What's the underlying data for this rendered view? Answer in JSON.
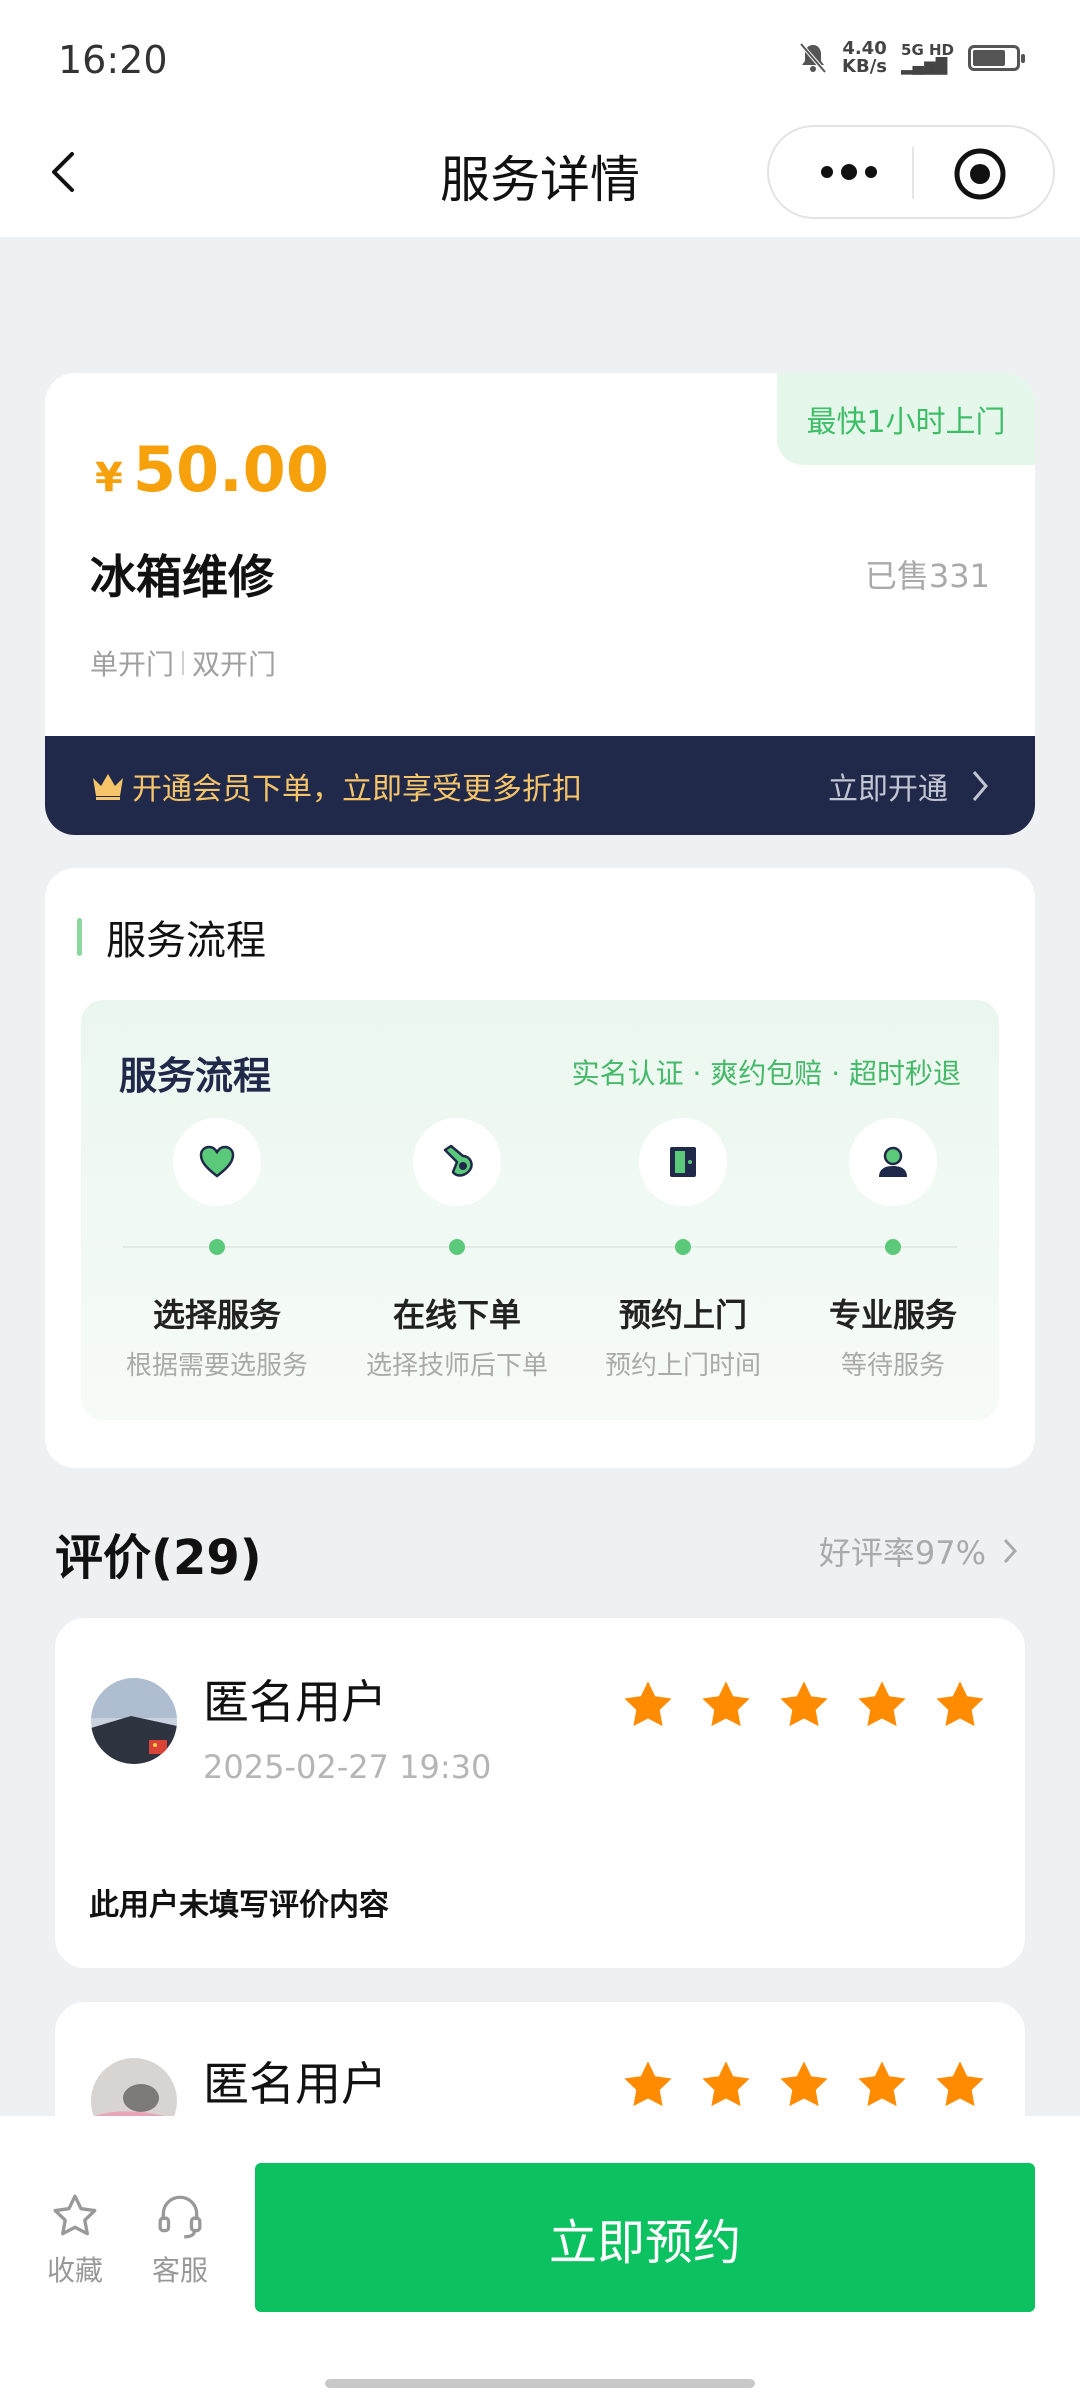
{
  "status_bar": {
    "time": "16:20",
    "net_speed": "4.40",
    "net_unit": "KB/s",
    "signal": "5G HD"
  },
  "nav": {
    "title": "服务详情"
  },
  "product": {
    "fast_badge": "最快1小时上门",
    "currency": "¥",
    "price": "50.00",
    "name": "冰箱维修",
    "sold": "已售331",
    "specs": [
      "单开门",
      "双开门"
    ],
    "vip_text": "开通会员下单，立即享受更多折扣",
    "vip_action": "立即开通"
  },
  "flow": {
    "section_title": "服务流程",
    "box_title": "服务流程",
    "tags": "实名认证 · 爽约包赔 · 超时秒退",
    "steps": [
      {
        "name": "选择服务",
        "desc": "根据需要选服务",
        "icon": "heart-icon"
      },
      {
        "name": "在线下单",
        "desc": "选择技师后下单",
        "icon": "tap-hand-icon"
      },
      {
        "name": "预约上门",
        "desc": "预约上门时间",
        "icon": "door-icon"
      },
      {
        "name": "专业服务",
        "desc": "等待服务",
        "icon": "person-icon"
      }
    ]
  },
  "reviews": {
    "title": "评价(29)",
    "good_rate": "好评率97%",
    "items": [
      {
        "user": "匿名用户",
        "date": "2025-02-27 19:30",
        "rating": 5,
        "text": "此用户未填写评价内容"
      },
      {
        "user": "匿名用户",
        "rating": 5
      }
    ]
  },
  "bottom": {
    "favorite": "收藏",
    "service": "客服",
    "book": "立即预约"
  },
  "colors": {
    "primary": "#0bc160",
    "price": "#f6a00c",
    "star": "#ff8c00",
    "vip_bar": "#20294a"
  }
}
